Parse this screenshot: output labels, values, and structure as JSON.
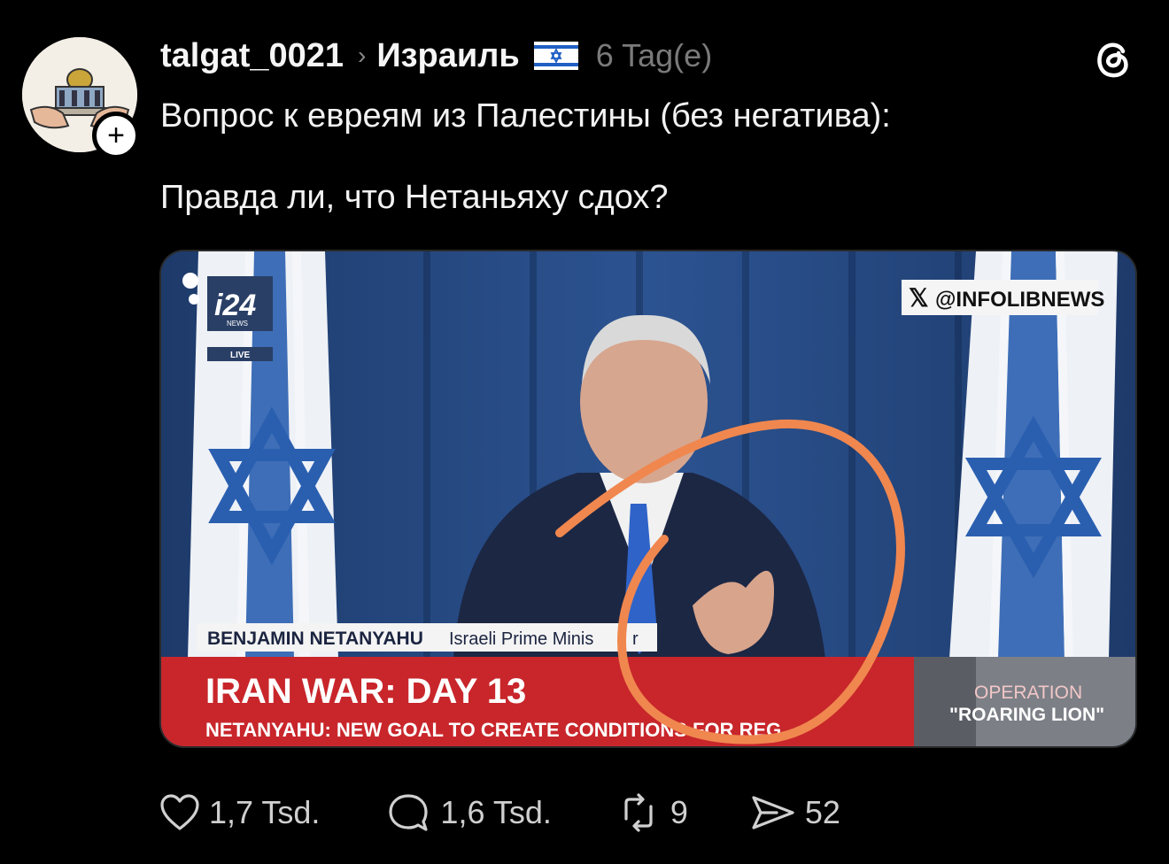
{
  "post": {
    "author": "talgat_0021",
    "separator": "›",
    "community": "Израиль",
    "time": "6 Tag(e)",
    "text_line1": "Вопрос к евреям из Палестины (без негатива):",
    "text_line2": "Правда ли, что Нетаньяху сдох?"
  },
  "media": {
    "channel_logo": "i24",
    "channel_sub": "NEWS",
    "live_badge": "LIVE",
    "watermark": "@INFOLIBNEWS",
    "name_bar": "BENJAMIN NETANYAHU",
    "name_title": "Israeli Prime Minis",
    "title_suffix": "r",
    "headline": "IRAN WAR: DAY 13",
    "subheadline": "NETANYAHU: NEW GOAL TO CREATE CONDITIONS FOR REG",
    "operation_line1": "OPERATION",
    "operation_line2": "\"ROARING LION\"",
    "circle_color": "#f0874f"
  },
  "actions": {
    "likes": "1,7 Tsd.",
    "replies": "1,6 Tsd.",
    "reposts": "9",
    "shares": "52"
  },
  "icons": [
    "avatar",
    "plus-icon",
    "chevron-right-icon",
    "israel-flag-icon",
    "threads-logo-icon",
    "heart-icon",
    "comment-icon",
    "repost-icon",
    "send-icon"
  ]
}
